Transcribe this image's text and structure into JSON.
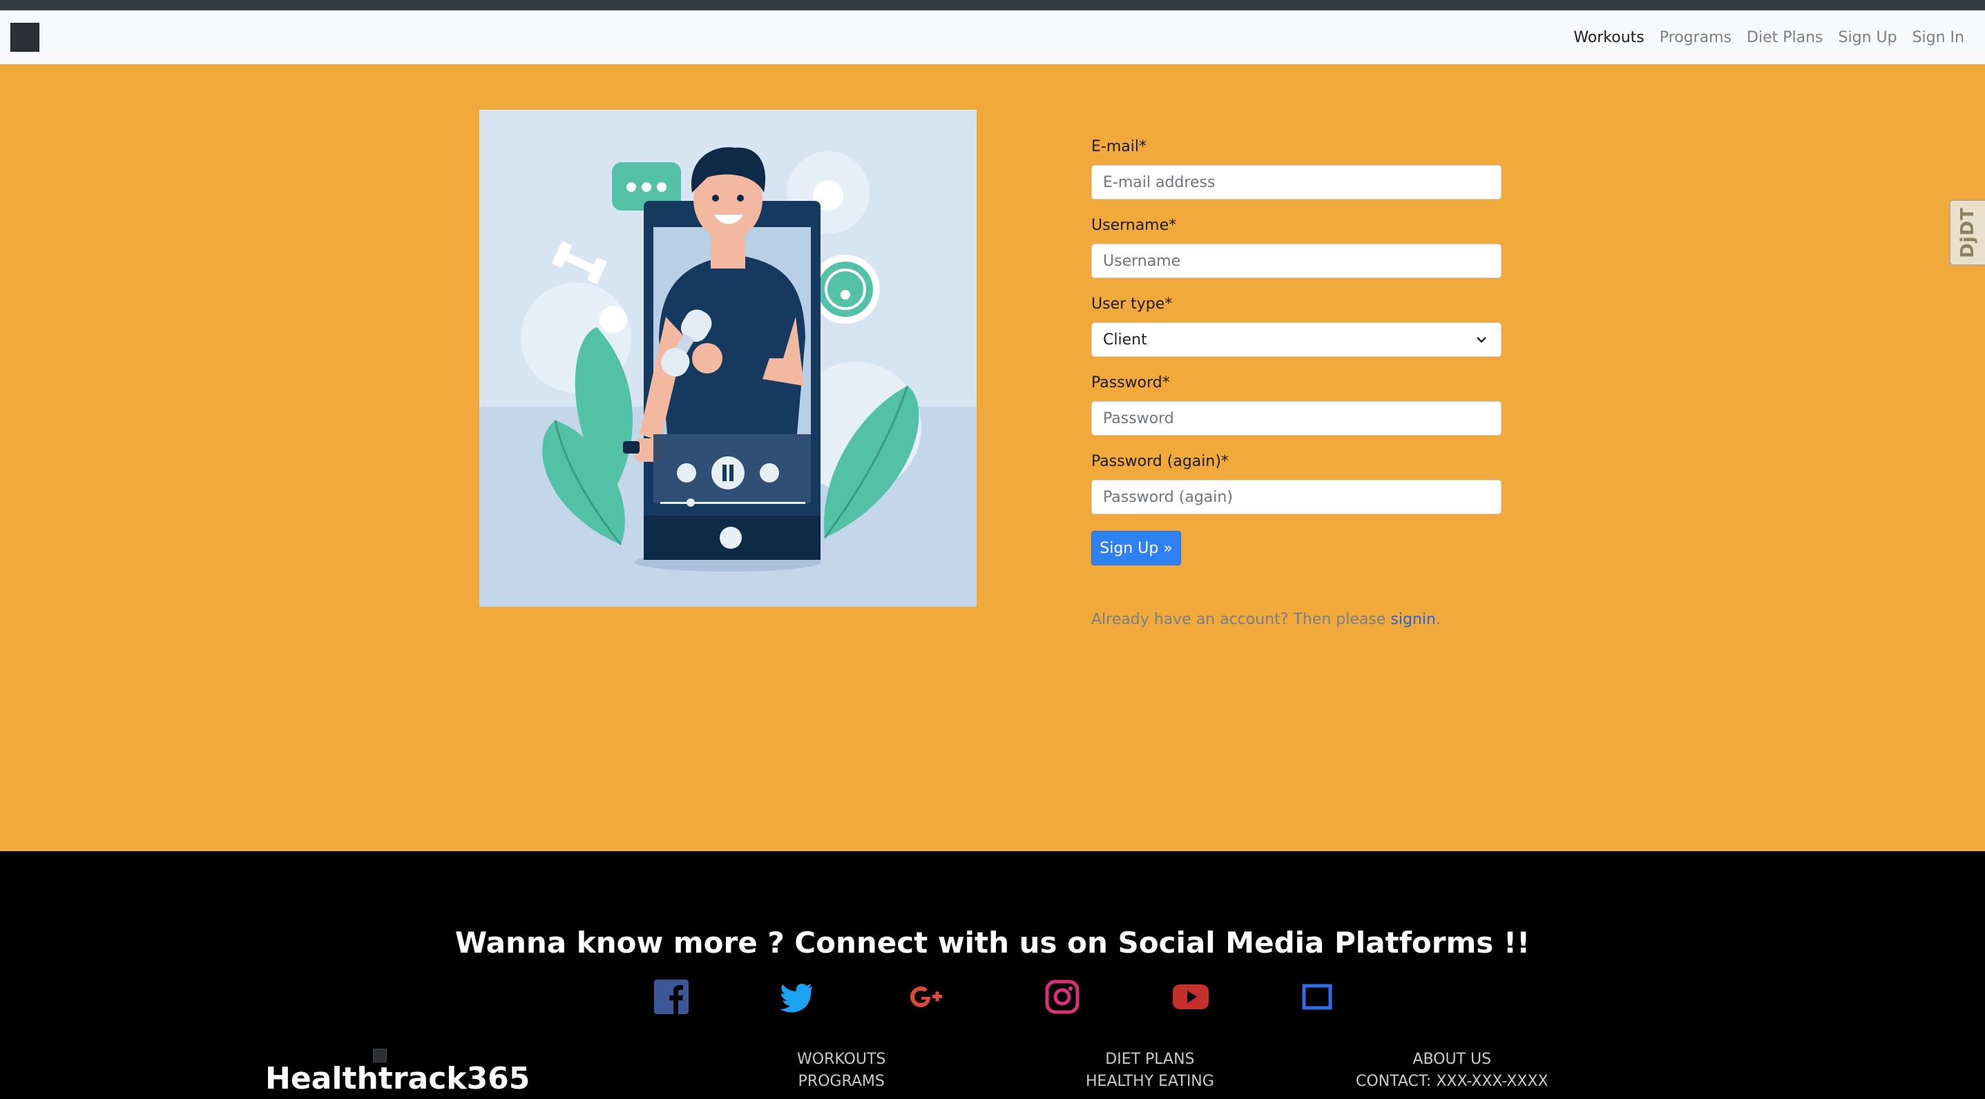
{
  "nav": {
    "items": [
      {
        "label": "Workouts",
        "active": true
      },
      {
        "label": "Programs",
        "active": false
      },
      {
        "label": "Diet Plans",
        "active": false
      },
      {
        "label": "Sign Up",
        "active": false
      },
      {
        "label": "Sign In",
        "active": false
      }
    ]
  },
  "form": {
    "email_label": "E-mail*",
    "email_placeholder": "E-mail address",
    "username_label": "Username*",
    "username_placeholder": "Username",
    "usertype_label": "User type*",
    "usertype_value": "Client",
    "password_label": "Password*",
    "password_placeholder": "Password",
    "password2_label": "Password (again)*",
    "password2_placeholder": "Password (again)",
    "submit_label": "Sign Up »",
    "already_text": "Already have an account? Then please ",
    "signin_link": "signin",
    "already_suffix": "."
  },
  "debug_toolbar": {
    "label": "DjDT"
  },
  "footer": {
    "heading": "Wanna know more ? Connect with us on Social Media Platforms !!",
    "brand": "Healthtrack365",
    "social": [
      "facebook-icon",
      "twitter-icon",
      "google-plus-icon",
      "instagram-icon",
      "youtube-icon",
      "square-icon"
    ],
    "col1": [
      "WORKOUTS",
      "PROGRAMS"
    ],
    "col2": [
      "DIET PLANS",
      "HEALTHY EATING"
    ],
    "col3": [
      "ABOUT US",
      "CONTACT: XXX-XXX-XXXX"
    ]
  },
  "colors": {
    "main_bg": "#f1a93b",
    "primary_button": "#2f80f0",
    "footer_bg": "#000000"
  }
}
